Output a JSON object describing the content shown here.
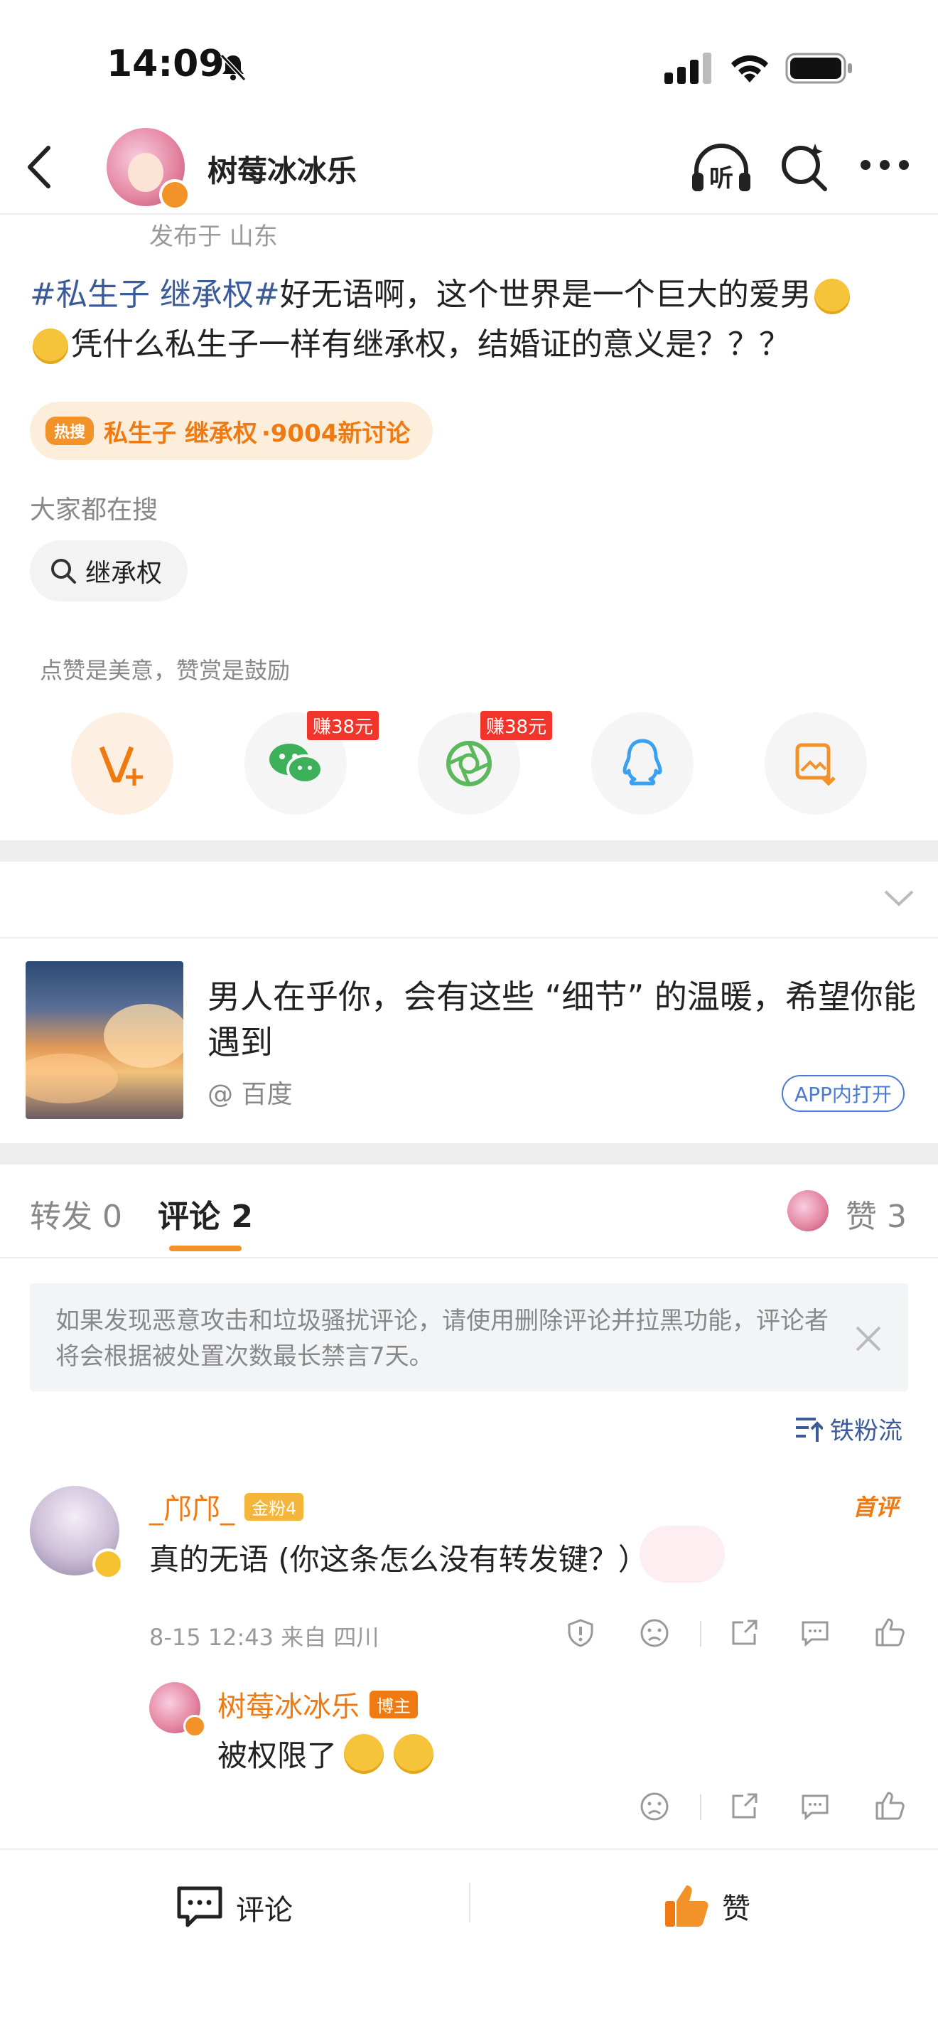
{
  "status_bar": {
    "time": "14:09"
  },
  "header": {
    "username": "树莓冰冰乐",
    "listen_label": "听",
    "back_icon": "chevron-left-icon",
    "listen_icon": "headphones-icon",
    "search_icon": "search-sparkle-icon",
    "more_icon": "more-dots-icon"
  },
  "post": {
    "location": "发布于 山东",
    "topic": "#私生子 继承权#",
    "text_a": "好无语啊，这个世界是一个巨大的爱男",
    "text_b": "凭什么私生子一样有继承权，结婚证的意义是？？？",
    "hot_badge": "热搜",
    "hot_topic": "私生子 继承权",
    "hot_count": "·9004新讨论",
    "search_section_title": "大家都在搜",
    "search_suggestion": "继承权"
  },
  "share": {
    "hint": "点赞是美意，赞赏是鼓励",
    "earn_wechat": "赚38元",
    "earn_moments": "赚38元",
    "icons": [
      "tip-v-icon",
      "wechat-icon",
      "moments-icon",
      "qq-icon",
      "save-image-icon"
    ]
  },
  "article": {
    "title": "男人在乎你，会有这些 “细节” 的温暖，希望你能遇到",
    "source": "@ 百度",
    "open_in_app": "APP内打开"
  },
  "tabs": {
    "repost": "转发 0",
    "comments": "评论 2",
    "likes": "赞 3"
  },
  "notice": {
    "text": "如果发现恶意攻击和垃圾骚扰评论，请使用删除评论并拉黑功能，评论者将会根据被处置次数最长禁言7天。"
  },
  "sort": {
    "label": "铁粉流"
  },
  "comments": [
    {
      "name": "_邝邝_",
      "badge": "金粉4",
      "first_tag": "首评",
      "text": "真的无语 (你这条怎么没有转发键？）",
      "meta": "8-15 12:43  来自 四川"
    }
  ],
  "reply": {
    "name": "树莓冰冰乐",
    "badge": "博主",
    "text": "被权限了"
  },
  "bottom_bar": {
    "comment_label": "评论",
    "like_label": "赞"
  },
  "colors": {
    "accent_orange": "#f07a12",
    "topic_blue": "#3a5a9a",
    "earn_red": "#f2352b",
    "wechat_green": "#3db05a",
    "qq_blue": "#3aa0f0"
  }
}
